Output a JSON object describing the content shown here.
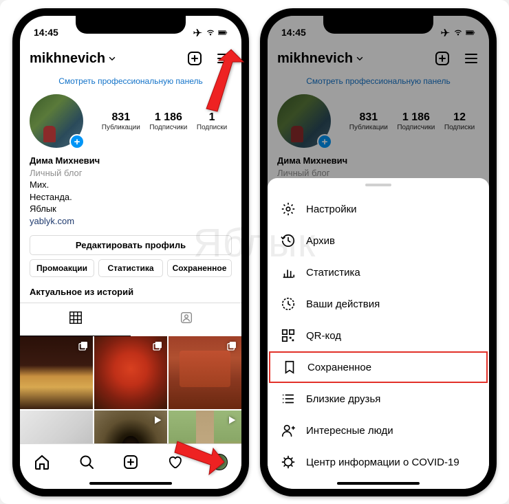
{
  "watermark": "Яблык",
  "status": {
    "time": "14:45"
  },
  "header": {
    "username": "mikhnevich"
  },
  "banner": {
    "pro_panel": "Смотреть профессиональную панель"
  },
  "stats": {
    "posts": {
      "value": "831",
      "label": "Публикации"
    },
    "followers": {
      "value": "1 186",
      "label": "Подписчики"
    },
    "following": {
      "value": "12",
      "label": "Подписки"
    },
    "following_hidden": {
      "value": "1",
      "label": "Подписки"
    }
  },
  "bio": {
    "name": "Дима Михневич",
    "category": "Личный блог",
    "line1": "Мих.",
    "line2": "Нестанда.",
    "line3": "Яблык",
    "site": "yablyk.com"
  },
  "buttons": {
    "edit": "Редактировать профиль",
    "promo": "Промоакции",
    "stats": "Статистика",
    "saved": "Сохраненное"
  },
  "section": {
    "highlights": "Актуальное из историй"
  },
  "menu": {
    "settings": "Настройки",
    "archive": "Архив",
    "stats": "Статистика",
    "activity": "Ваши действия",
    "qr": "QR-код",
    "saved": "Сохраненное",
    "close_friends": "Близкие друзья",
    "discover": "Интересные люди",
    "covid": "Центр информации о COVID-19"
  }
}
